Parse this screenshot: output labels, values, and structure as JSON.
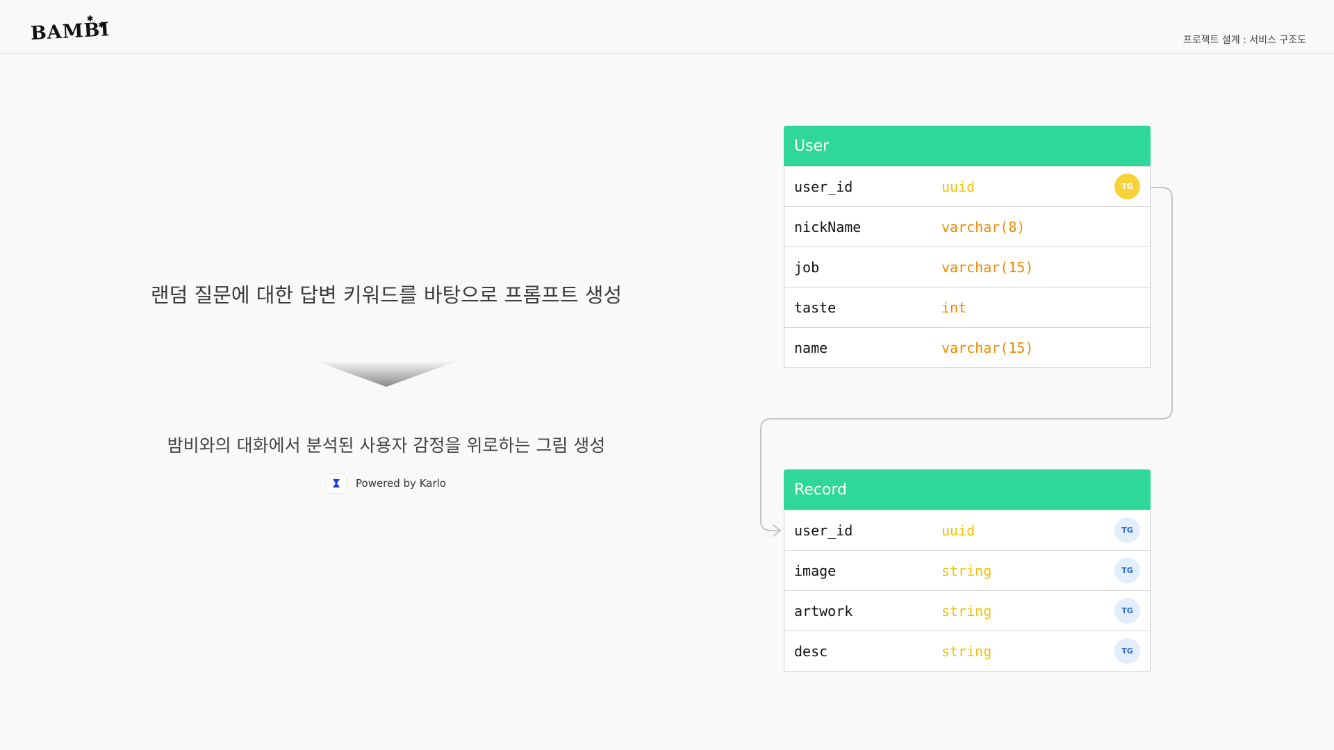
{
  "header": {
    "logo": "BAMBI",
    "doc_title": "프로젝트 설계 : 서비스 구조도"
  },
  "flow": {
    "lead": "랜덤 질문에 대한 답변 키워드를 바탕으로 프롬프트 생성",
    "result": "밤비와의 대화에서 분석된 사용자 감정을 위로하는 그림 생성",
    "powered_by": "Powered by Karlo",
    "karlo_icon": "karlo-logo-icon"
  },
  "colors": {
    "table_header": "#2fd898",
    "type_uuid": "#f5c000",
    "type_varchar": "#f08a00",
    "badge_yellow": "#f9d23a",
    "badge_blue_bg": "#e3eefc",
    "badge_blue_text": "#2c6bd6",
    "connector": "#c4c4c4"
  },
  "tables": {
    "user": {
      "title": "User",
      "rows": [
        {
          "name": "user_id",
          "type": "uuid",
          "badge": "TG"
        },
        {
          "name": "nickName",
          "type": "varchar(8)"
        },
        {
          "name": "job",
          "type": "varchar(15)"
        },
        {
          "name": "taste",
          "type": "int"
        },
        {
          "name": "name",
          "type": "varchar(15)"
        }
      ]
    },
    "record": {
      "title": "Record",
      "rows": [
        {
          "name": "user_id",
          "type": "uuid",
          "badge": "TG"
        },
        {
          "name": "image",
          "type": "string",
          "badge": "TG"
        },
        {
          "name": "artwork",
          "type": "string",
          "badge": "TG"
        },
        {
          "name": "desc",
          "type": "string",
          "badge": "TG"
        }
      ]
    }
  }
}
